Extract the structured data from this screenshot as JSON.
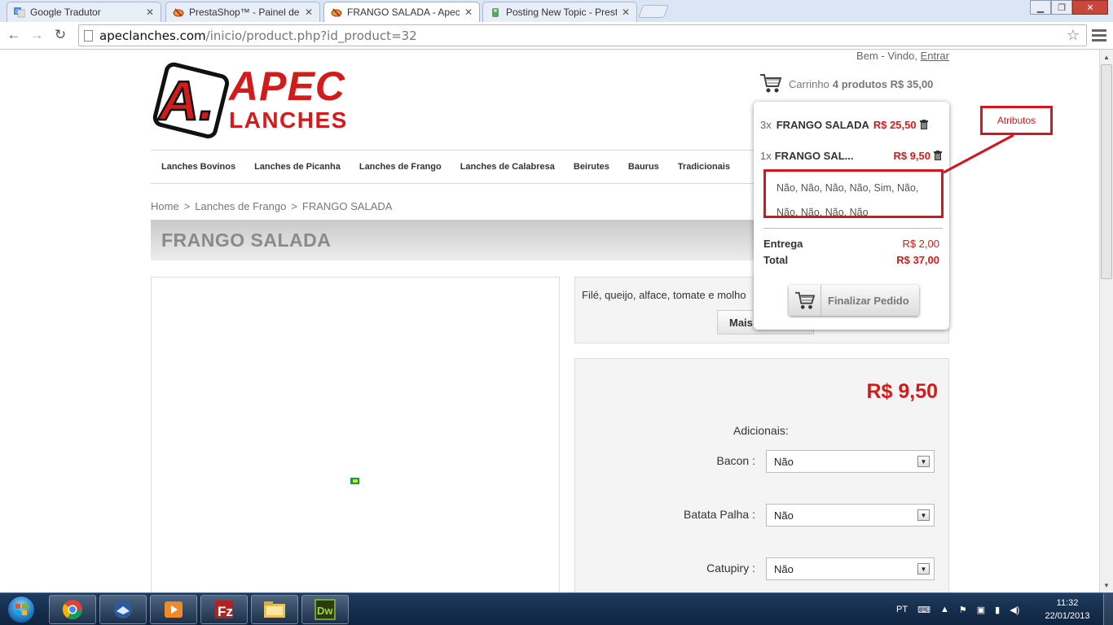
{
  "browser": {
    "tabs": [
      {
        "title": "Google Tradutor",
        "icon": "google-translate-icon",
        "active": false
      },
      {
        "title": "PrestaShop™ - Painel de A",
        "icon": "prestashop-icon",
        "active": false
      },
      {
        "title": "FRANGO SALADA - Apec L",
        "icon": "prestashop-icon",
        "active": true
      },
      {
        "title": "Posting New Topic - Prest",
        "icon": "forum-icon",
        "active": false
      }
    ],
    "url_domain": "apeclanches.com",
    "url_path": "/inicio/product.php?id_product=32"
  },
  "header": {
    "welcome_text": "Bem - Vindo,",
    "login_link": "Entrar",
    "logo_text_top": "APEC",
    "logo_text_bottom": "LANCHES",
    "logo_letter": "A.",
    "cart_label": "Carrinho",
    "cart_summary": "4 produtos R$ 35,00"
  },
  "nav": {
    "items": [
      "Lanches Bovinos",
      "Lanches de Picanha",
      "Lanches de Frango",
      "Lanches de Calabresa",
      "Beirutes",
      "Baurus",
      "Tradicionais"
    ]
  },
  "breadcrumb": {
    "home": "Home",
    "sep": ">",
    "category": "Lanches de Frango",
    "current": "FRANGO SALADA"
  },
  "product": {
    "title": "FRANGO SALADA",
    "description": "Filé, queijo, alface, tomate e molho",
    "more_button": "Mais",
    "price": "R$ 9,50",
    "addons_label": "Adicionais:",
    "options": [
      {
        "label": "Bacon :",
        "value": "Não"
      },
      {
        "label": "Batata Palha :",
        "value": "Não"
      },
      {
        "label": "Catupiry :",
        "value": "Não"
      }
    ]
  },
  "cart_dropdown": {
    "lines": [
      {
        "qty": "3x",
        "name": "FRANGO SALADA",
        "price": "R$ 25,50"
      },
      {
        "qty": "1x",
        "name": "FRANGO SAL...",
        "price": "R$ 9,50"
      }
    ],
    "attributes_line1": "Não, Não, Não, Não, Sim, Não,",
    "attributes_line2": "Não, Não, Não, Não",
    "delivery_label": "Entrega",
    "delivery_value": "R$ 2,00",
    "total_label": "Total",
    "total_value": "R$ 37,00",
    "checkout_label": "Finalizar Pedido"
  },
  "annotation": {
    "label": "Atributos",
    "color": "#d0181e"
  },
  "taskbar": {
    "apps": [
      "chrome-icon",
      "thunderbird-icon",
      "media-player-icon",
      "filezilla-icon",
      "explorer-icon",
      "dreamweaver-icon"
    ],
    "lang": "PT",
    "time": "11:32",
    "date": "22/01/2013"
  },
  "colors": {
    "brand_red": "#d21c1c",
    "page_text": "#333333"
  }
}
